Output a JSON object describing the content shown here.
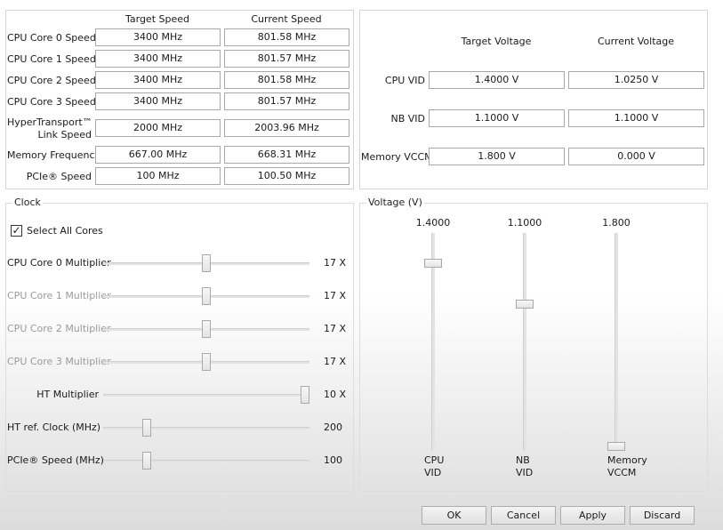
{
  "speed_table": {
    "col_target": "Target Speed",
    "col_current": "Current Speed",
    "rows": [
      {
        "label": "CPU Core 0 Speed",
        "target": "3400 MHz",
        "current": "801.58 MHz"
      },
      {
        "label": "CPU Core 1 Speed",
        "target": "3400 MHz",
        "current": "801.57 MHz"
      },
      {
        "label": "CPU Core 2 Speed",
        "target": "3400 MHz",
        "current": "801.58 MHz"
      },
      {
        "label": "CPU Core 3 Speed",
        "target": "3400 MHz",
        "current": "801.57 MHz"
      },
      {
        "label_line1": "HyperTransport™",
        "label_line2": "Link Speed",
        "target": "2000 MHz",
        "current": "2003.96 MHz"
      },
      {
        "label": "Memory Frequency",
        "target": "667.00 MHz",
        "current": "668.31 MHz"
      },
      {
        "label": "PCIe® Speed",
        "target": "100 MHz",
        "current": "100.50 MHz"
      }
    ]
  },
  "voltage_table": {
    "col_target": "Target Voltage",
    "col_current": "Current Voltage",
    "rows": [
      {
        "label": "CPU VID",
        "target": "1.4000 V",
        "current": "1.0250 V"
      },
      {
        "label": "NB VID",
        "target": "1.1000 V",
        "current": "1.1000 V"
      },
      {
        "label": "Memory VCCM",
        "target": "1.800 V",
        "current": "0.000 V"
      }
    ]
  },
  "clock": {
    "title": "Clock",
    "select_all_label": "Select All Cores",
    "select_all_checked": true,
    "sliders": [
      {
        "label": "CPU Core 0 Multiplier",
        "value": "17 X",
        "enabled": true,
        "position": 0.5
      },
      {
        "label": "CPU Core 1 Multiplier",
        "value": "17 X",
        "enabled": false,
        "position": 0.5
      },
      {
        "label": "CPU Core 2 Multiplier",
        "value": "17 X",
        "enabled": false,
        "position": 0.5
      },
      {
        "label": "CPU Core 3 Multiplier",
        "value": "17 X",
        "enabled": false,
        "position": 0.5
      },
      {
        "label": "HT Multiplier",
        "value": "10 X",
        "enabled": true,
        "position": 1.0
      },
      {
        "label": "HT ref. Clock (MHz)",
        "value": "200",
        "enabled": true,
        "position": 0.2
      },
      {
        "label": "PCIe® Speed (MHz)",
        "value": "100",
        "enabled": true,
        "position": 0.2
      }
    ]
  },
  "voltage": {
    "title": "Voltage (V)",
    "sliders": [
      {
        "top_value": "1.4000",
        "label_line1": "CPU",
        "label_line2": "VID",
        "position": 0.875
      },
      {
        "top_value": "1.1000",
        "label_line1": "NB",
        "label_line2": "VID",
        "position": 0.68
      },
      {
        "top_value": "1.800",
        "label_line1": "Memory",
        "label_line2": "VCCM",
        "position": 0.0
      }
    ]
  },
  "buttons": {
    "ok": "OK",
    "cancel": "Cancel",
    "apply": "Apply",
    "discard": "Discard"
  }
}
